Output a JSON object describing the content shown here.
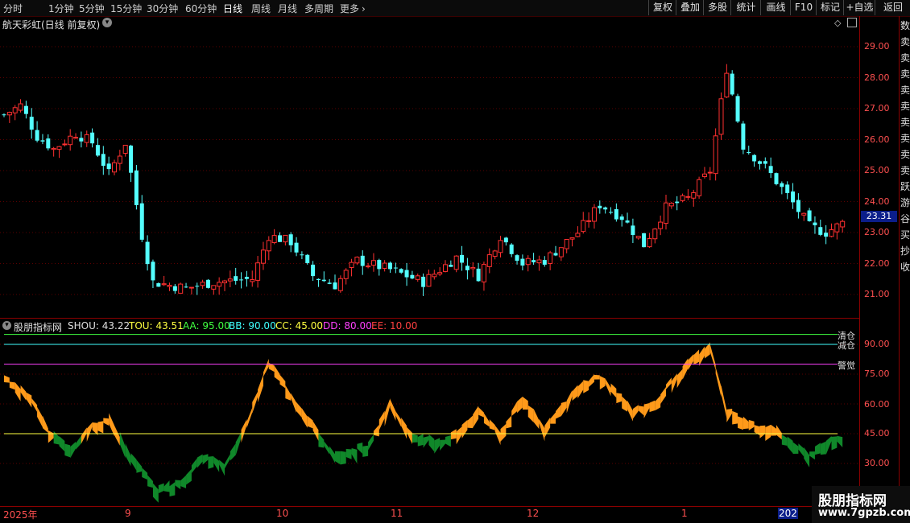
{
  "toolbar": {
    "tabs": [
      "分时",
      "1分钟",
      "5分钟",
      "15分钟",
      "30分钟",
      "60分钟",
      "日线",
      "周线",
      "月线",
      "多周期",
      "更多"
    ],
    "active_tab": "日线",
    "right_buttons": [
      "复权",
      "叠加",
      "多股",
      "统计",
      "画线",
      "F10",
      "标记",
      "+自选",
      "返回"
    ]
  },
  "main_chart": {
    "title": "航天彩虹(日线 前复权)",
    "price_axis": [
      "29.00",
      "28.00",
      "27.00",
      "26.00",
      "25.00",
      "24.00",
      "23.00",
      "22.00",
      "21.00"
    ],
    "current_price": "23.31",
    "colors": {
      "up": "#ff3030",
      "down": "#54ffff",
      "price_tag": "#0b1e8a"
    }
  },
  "indicator": {
    "name": "股朋指标网",
    "legend": [
      {
        "label": "SHOU:",
        "value": "43.22",
        "color": "#e0e0e0"
      },
      {
        "label": "TOU:",
        "value": "43.51",
        "color": "#ffff40"
      },
      {
        "label": "AA:",
        "value": "95.00",
        "color": "#40ff40"
      },
      {
        "label": "BB:",
        "value": "90.00",
        "color": "#40ffff"
      },
      {
        "label": "CC:",
        "value": "45.00",
        "color": "#ffff40"
      },
      {
        "label": "DD:",
        "value": "80.00",
        "color": "#ff40ff"
      },
      {
        "label": "EE:",
        "value": "10.00",
        "color": "#ff4040"
      }
    ],
    "axis": [
      "90.00",
      "75.00",
      "60.00",
      "45.00",
      "30.00"
    ],
    "line_labels": {
      "aa": "清仓",
      "bb": "减仓",
      "dd": "警觉"
    },
    "colors": {
      "up_fill": "#ff9a1a",
      "down_fill": "#10882a"
    }
  },
  "date_axis": [
    "2025年",
    "9",
    "10",
    "11",
    "12",
    "1",
    "202"
  ],
  "right_strip": [
    "数",
    "卖",
    "卖",
    "卖",
    "卖",
    "卖",
    "卖",
    "卖",
    "卖",
    "卖",
    "跃",
    "游",
    "谷",
    "买",
    "抄",
    "收"
  ],
  "watermark": {
    "line1": "股朋指标网",
    "line2": "www.7gpzb.com"
  }
}
